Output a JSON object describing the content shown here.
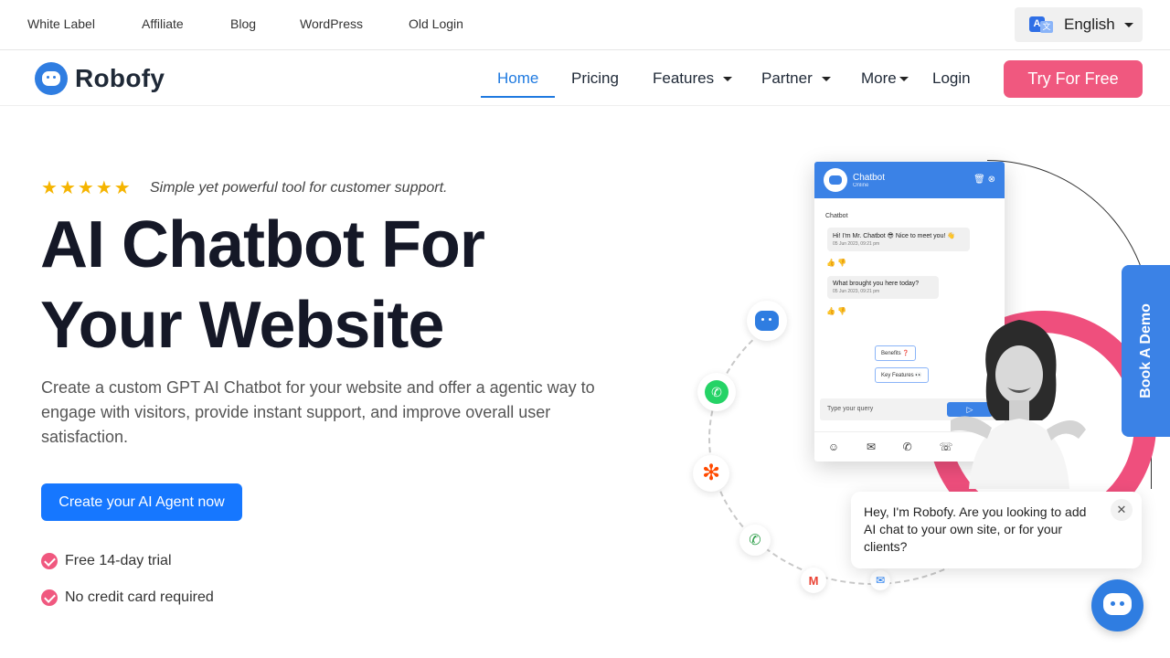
{
  "topbar": {
    "links": [
      "White Label",
      "Affiliate",
      "Blog",
      "WordPress",
      "Old Login"
    ],
    "language": "English"
  },
  "nav": {
    "brand": "Robofy",
    "items": [
      "Home",
      "Pricing",
      "Features",
      "Partner",
      "More",
      "Login"
    ],
    "active": "Home",
    "cta": "Try For Free"
  },
  "hero": {
    "rating_stars": 5,
    "tagline": "Simple yet powerful tool for customer support.",
    "title_line1": "AI Chatbot For",
    "title_line2": "Your Website",
    "subtitle": "Create a custom GPT AI Chatbot for your website and offer a agentic way to engage with visitors, provide instant support, and improve overall user satisfaction.",
    "cta": "Create your AI Agent now",
    "checks": [
      "Free 14-day trial",
      "No credit card required"
    ]
  },
  "chat_widget": {
    "title": "Chatbot",
    "status": "Online",
    "sender": "Chatbot",
    "messages": [
      {
        "text": "Hi! I'm Mr. Chatbot 😎 Nice to meet you! 👋",
        "time": "05 Jun 2023, 09:21 pm"
      },
      {
        "text": "What brought you here today?",
        "time": "05 Jun 2023, 09:21 pm"
      }
    ],
    "chips": [
      "Benefits ❓",
      "Key Features 👀"
    ],
    "input_placeholder": "Type your query"
  },
  "demo_tab": "Book A Demo",
  "greeting": "Hey, I'm Robofy. Are you looking to add AI chat to your own site, or for your clients?",
  "colors": {
    "primary": "#1677ff",
    "accent_pink": "#f0587f",
    "widget_blue": "#3b82e6"
  }
}
